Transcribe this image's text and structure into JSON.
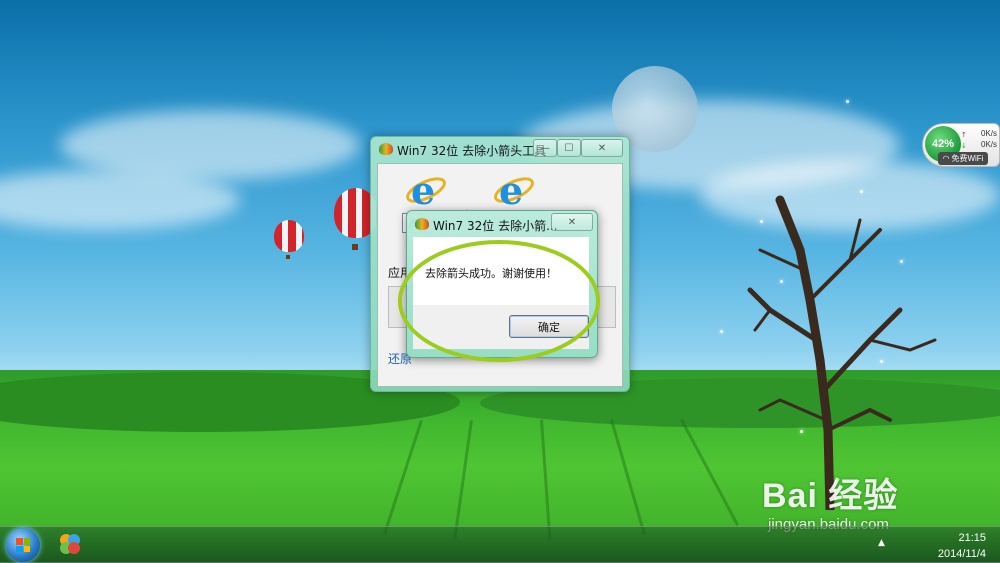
{
  "main_window": {
    "title": "Win7 32位 去除小箭头工具",
    "apply_label": "应用",
    "restore_link": "还原"
  },
  "dialog": {
    "title": "Win7 32位 去除小箭...",
    "message": "去除箭头成功。谢谢使用！",
    "ok_label": "确定"
  },
  "net_widget": {
    "percent": "42%",
    "upload_speed": "0K/s",
    "download_speed": "0K/s",
    "wifi_label": "免费WiFi"
  },
  "taskbar": {
    "time": "21:15",
    "date": "2014/11/4"
  },
  "watermark": {
    "logo_text": "Bai 经验",
    "url": "jingyan.baidu.com"
  },
  "colors": {
    "highlight_ring": "#9ccc1e",
    "window_frame": "#aae6d2",
    "link": "#1a63b5"
  }
}
